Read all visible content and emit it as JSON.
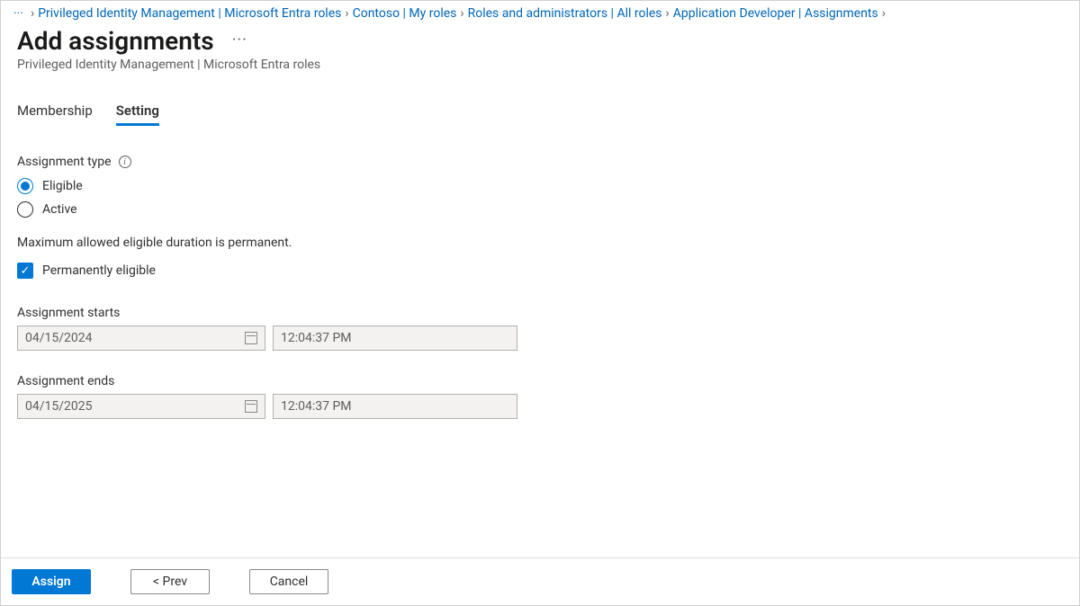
{
  "breadcrumb": {
    "ellipsis": "···",
    "items": [
      "Privileged Identity Management | Microsoft Entra roles",
      "Contoso | My roles",
      "Roles and administrators | All roles",
      "Application Developer | Assignments"
    ]
  },
  "header": {
    "title": "Add assignments",
    "more": "···",
    "subtitle": "Privileged Identity Management | Microsoft Entra roles"
  },
  "tabs": {
    "membership": "Membership",
    "setting": "Setting"
  },
  "form": {
    "assignment_type_label": "Assignment type",
    "radio_eligible": "Eligible",
    "radio_active": "Active",
    "duration_note": "Maximum allowed eligible duration is permanent.",
    "perm_eligible": "Permanently eligible",
    "starts_label": "Assignment starts",
    "starts_date": "04/15/2024",
    "starts_time": "12:04:37 PM",
    "ends_label": "Assignment ends",
    "ends_date": "04/15/2025",
    "ends_time": "12:04:37 PM"
  },
  "footer": {
    "assign": "Assign",
    "prev": "<  Prev",
    "cancel": "Cancel"
  }
}
